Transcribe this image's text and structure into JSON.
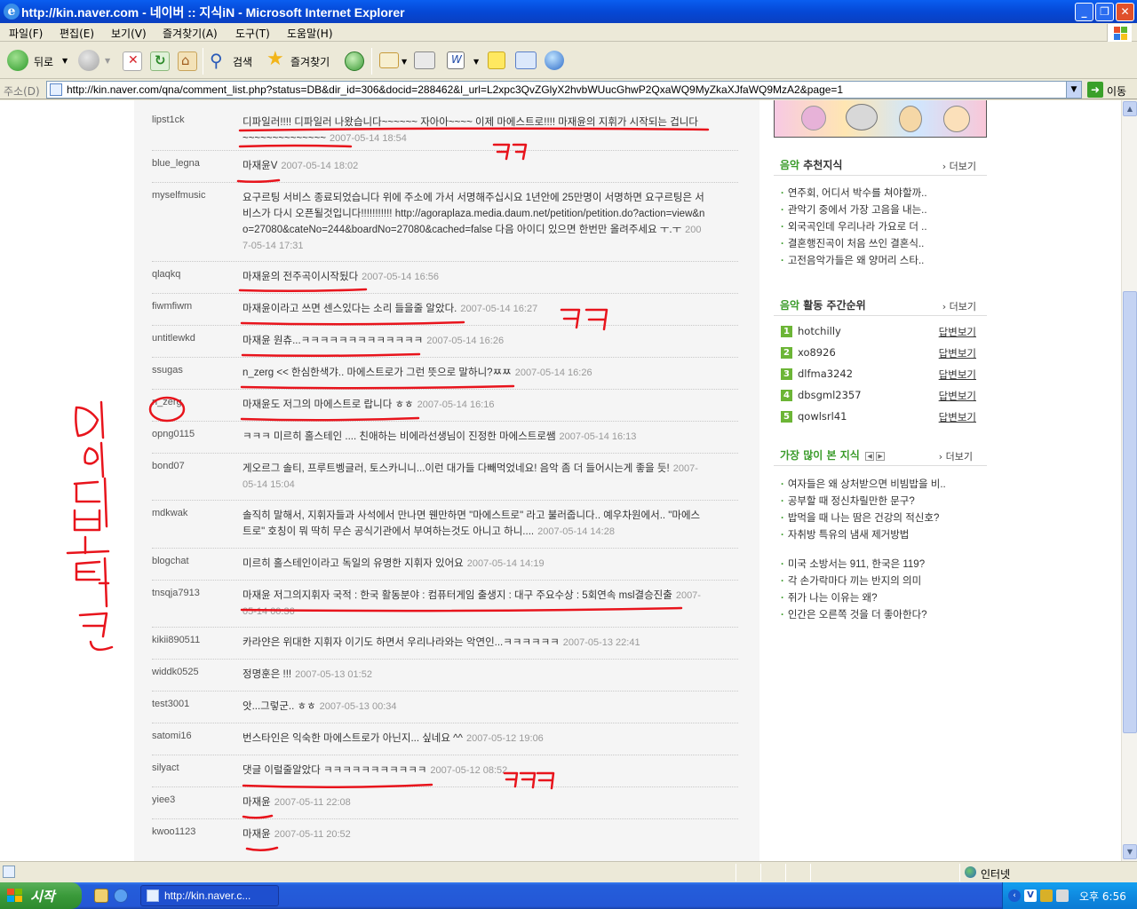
{
  "window": {
    "title": "http://kin.naver.com - 네이버 :: 지식iN - Microsoft Internet Explorer",
    "btn_min": "_",
    "btn_max": "❐",
    "btn_close": "✕"
  },
  "menu": [
    "파일(F)",
    "편집(E)",
    "보기(V)",
    "즐겨찾기(A)",
    "도구(T)",
    "도움말(H)"
  ],
  "toolbar": {
    "back": "뒤로",
    "search": "검색",
    "favorites": "즐겨찾기"
  },
  "address": {
    "label": "주소(D)",
    "url": "http://kin.naver.com/qna/comment_list.php?status=DB&dir_id=306&docid=288462&l_url=L2xpc3QvZGlyX2hvbWUucGhwP2QxaWQ9MyZkaXJfaWQ9MzA2&page=1",
    "go": "이동"
  },
  "comments": [
    {
      "user": "lipst1ck",
      "text": "디파일러!!!! 디파일러 나왔습니다~~~~~~ 자아아~~~~ 이제 마에스트로!!!! 마재윤의 지휘가 시작되는 겁니다~~~~~~~~~~~~~~",
      "date": "2007-05-14 18:54"
    },
    {
      "user": "blue_legna",
      "text": "마재윤V",
      "date": "2007-05-14 18:02"
    },
    {
      "user": "myselfmusic",
      "text": "요구르팅 서비스 종료되었습니다 위에 주소에 가서 서명해주십시요 1년안에 25만명이 서명하면 요구르팅은 서비스가 다시 오픈될것입니다!!!!!!!!!!! http://agoraplaza.media.daum.net/petition/petition.do?action=view&no=27080&cateNo=244&boardNo=27080&cached=false 다음 아이디 있으면 한번만 올려주세요 ㅜ.ㅜ",
      "date": "2007-05-14 17:31"
    },
    {
      "user": "qlaqkq",
      "text": "마재윤의 전주곡이시작됬다",
      "date": "2007-05-14 16:56"
    },
    {
      "user": "fiwmfiwm",
      "text": "마재윤이라고 쓰면 센스있다는 소리 들을줄 알았다.",
      "date": "2007-05-14 16:27"
    },
    {
      "user": "untitlewkd",
      "text": "마재윤 원츄...ㅋㅋㅋㅋㅋㅋㅋㅋㅋㅋㅋㅋㅋ",
      "date": "2007-05-14 16:26"
    },
    {
      "user": "ssugas",
      "text": "n_zerg << 한심한색갸.. 마에스트로가 그런 뜻으로 말하니?ㅉㅉ",
      "date": "2007-05-14 16:26"
    },
    {
      "user": "n_zerg",
      "text": "마재윤도 저그의 마에스트로 랍니다 ㅎㅎ",
      "date": "2007-05-14 16:16"
    },
    {
      "user": "opng0115",
      "text": "ㅋㅋㅋ 미르히 홀스테인 .... 친애하는 비에라선생님이 진정한 마에스트로쌤",
      "date": "2007-05-14 16:13"
    },
    {
      "user": "bond07",
      "text": "게오르그 솔티, 프루트벵글러, 토스카니니...이런 대가들 다빼먹었네요! 음악 좀 더 들어시는게 좋을 듯!",
      "date": "2007-05-14 15:04"
    },
    {
      "user": "mdkwak",
      "text": "솔직히 말해서, 지휘자들과 사석에서 만나면 웬만하면 \"마에스트로\" 라고 불러줍니다.. 예우차원에서.. \"마에스트로\" 호칭이 뭐 딱히 무슨 공식기관에서 부여하는것도 아니고 하니....",
      "date": "2007-05-14 14:28"
    },
    {
      "user": "blogchat",
      "text": "미르히 홀스테인이라고 독일의 유명한 지휘자 있어요",
      "date": "2007-05-14 14:19"
    },
    {
      "user": "tnsqja7913",
      "text": "마재윤 저그의지휘자 국적 : 한국 활동분야 : 컴퓨터게임 출생지 : 대구 주요수상 : 5회연속 msl결승진출",
      "date": "2007-05-14 00:36"
    },
    {
      "user": "kikii890511",
      "text": "카라얀은 위대한 지휘자 이기도 하면서 우리나라와는 악연인...ㅋㅋㅋㅋㅋㅋ",
      "date": "2007-05-13 22:41"
    },
    {
      "user": "widdk0525",
      "text": "정명훈은 !!!",
      "date": "2007-05-13 01:52"
    },
    {
      "user": "test3001",
      "text": "앗...그렇군.. ㅎㅎ",
      "date": "2007-05-13 00:34"
    },
    {
      "user": "satomi16",
      "text": "번스타인은 익숙한 마에스트로가 아닌지... 싶네요 ^^",
      "date": "2007-05-12 19:06"
    },
    {
      "user": "silyact",
      "text": "댓글 이럴줄알았다 ㅋㅋㅋㅋㅋㅋㅋㅋㅋㅋㅋ",
      "date": "2007-05-12 08:52"
    },
    {
      "user": "yiee3",
      "text": "마재윤",
      "date": "2007-05-11 22:08"
    },
    {
      "user": "kwoo1123",
      "text": "마재윤",
      "date": "2007-05-11 20:52"
    }
  ],
  "sidebar": {
    "rec": {
      "title_green": "음악",
      "title_rest": " 추천지식",
      "more": "› 더보기",
      "items": [
        "연주회, 어디서 박수를 쳐야할까..",
        "관악기 중에서 가장 고음을 내는..",
        "외국곡인데 우리나라 가요로 더 ..",
        "결혼행진곡이 처음 쓰인 결혼식..",
        "고전음악가들은 왜 양머리 스타.."
      ]
    },
    "rank": {
      "title_green": "음악",
      "title_rest": " 활동 주간순위",
      "more": "› 더보기",
      "link": "답변보기",
      "items": [
        {
          "num": "1",
          "name": "hotchilly"
        },
        {
          "num": "2",
          "name": "xo8926"
        },
        {
          "num": "3",
          "name": "dlfma3242"
        },
        {
          "num": "4",
          "name": "dbsgml2357"
        },
        {
          "num": "5",
          "name": "qowlsrl41"
        }
      ]
    },
    "popular": {
      "title": "가장 많이 본 지식",
      "more": "› 더보기",
      "prev": "◀",
      "next": "▶",
      "items_a": [
        "여자들은 왜 상처받으면 비빔밥을 비..",
        "공부할 때 정신차릴만한 문구?",
        "밥먹을 때 나는 땀은 건강의 적신호?",
        "자취방 특유의 냄새 제거방법"
      ],
      "items_b": [
        "미국 소방서는 911, 한국은 119?",
        "각 손가락마다 끼는 반지의 의미",
        "쥐가 나는 이유는 왜?",
        "인간은 오른쪽 것을 더 좋아한다?"
      ]
    }
  },
  "status": {
    "zone": "인터넷"
  },
  "taskbar": {
    "start": "시작",
    "task": "http://kin.naver.c...",
    "clock": "오후 6:56"
  },
  "colors": {
    "xp_blue": "#0548d6",
    "naver_green": "#3a9b2a",
    "markup_red": "#e8141c"
  }
}
